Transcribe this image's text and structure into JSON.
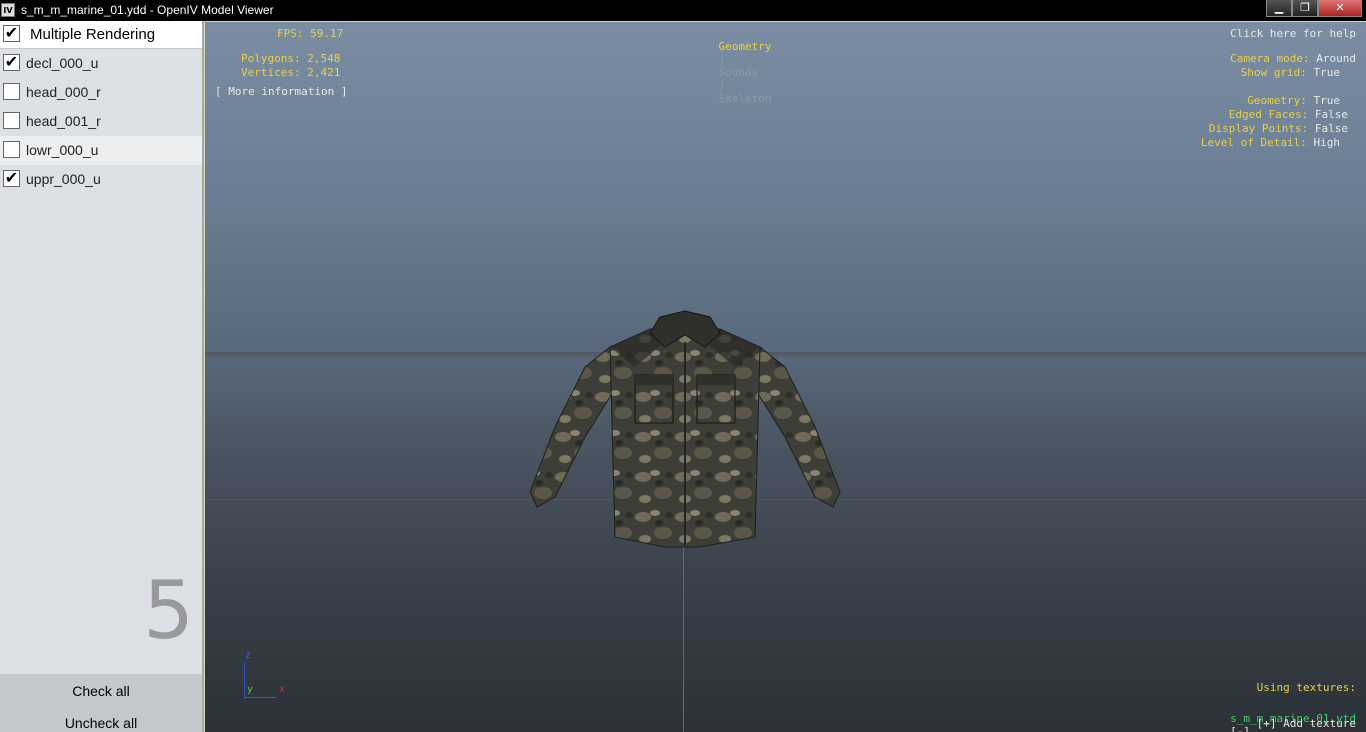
{
  "window": {
    "icon_text": "IV",
    "title": "s_m_m_marine_01.ydd - OpenIV Model Viewer",
    "minimize": "▁",
    "maximize": "❐",
    "close": "✕"
  },
  "left_panel": {
    "header": {
      "label": "Multiple Rendering",
      "checked": "✔"
    },
    "items": [
      {
        "label": "decl_000_u",
        "check": "✔"
      },
      {
        "label": "head_000_r",
        "check": ""
      },
      {
        "label": "head_001_r",
        "check": ""
      },
      {
        "label": "lowr_000_u",
        "check": ""
      },
      {
        "label": "uppr_000_u",
        "check": "✔"
      }
    ],
    "count": "5",
    "check_all": "Check all",
    "uncheck_all": "Uncheck all"
  },
  "viewport": {
    "fps": "FPS: 59.17",
    "polygons": "Polygons: 2,548",
    "vertices": "Vertices: 2,421",
    "more_info": "[ More information ]",
    "tabs": {
      "geometry": "Geometry",
      "sep1": "|",
      "sounds": "Sounds",
      "sep2": "|",
      "skeleton": "Skeleton"
    },
    "help": "Click here for help",
    "camera_mode_label": "Camera mode:",
    "camera_mode_value": "Around",
    "show_grid_label": "Show grid:",
    "show_grid_value": "True",
    "geometry_label": "Geometry:",
    "geometry_value": "True",
    "edged_faces_label": "Edged Faces:",
    "edged_faces_value": "False",
    "display_points_label": "Display Points:",
    "display_points_value": "False",
    "lod_label": "Level of Detail:",
    "lod_value": "High",
    "axis": {
      "z": "z",
      "y": "y",
      "x": "x"
    },
    "using_textures": "Using textures:",
    "texture_file": "s_m_m_marine_01.ytd",
    "remove": "[-]",
    "add_texture": "[+] Add texture"
  },
  "colors": {
    "hud_yellow": "#e6d14a",
    "hud_green": "#3fd26b",
    "sky_top": "#7a8da3",
    "ground_bottom": "#2c3138"
  }
}
